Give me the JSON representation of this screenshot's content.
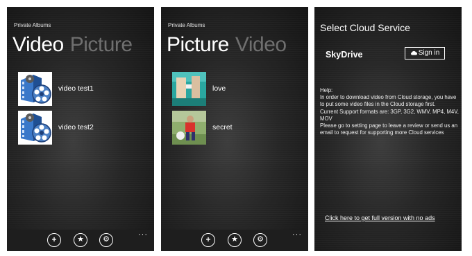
{
  "screens": {
    "video": {
      "app_name": "Private Albums",
      "pivot_active": "Video",
      "pivot_inactive": "Picture",
      "items": [
        {
          "label": "video test1"
        },
        {
          "label": "video test2"
        }
      ]
    },
    "picture": {
      "app_name": "Private Albums",
      "pivot_active": "Picture",
      "pivot_inactive": "Video",
      "items": [
        {
          "label": "love"
        },
        {
          "label": "secret"
        }
      ]
    },
    "cloud": {
      "title": "Select Cloud Service",
      "service": "SkyDrive",
      "signin_label": "Sign in",
      "help_lines": [
        "Help:",
        "In order to download video from Cloud storage, you have to put some video files in the Cloud storage first.",
        "Current Support formats are: 3GP, 3G2, WMV, MP4, M4V, MOV",
        "Please go to setting page to leave a review or send us an email to request for supporting more Cloud services"
      ],
      "full_version_link": "Click here to get full version with no ads"
    }
  },
  "appbar": {
    "add_glyph": "+",
    "favorite_glyph": "★",
    "settings_glyph": "⚙",
    "more_glyph": "···"
  },
  "icons": [
    "add-icon",
    "star-icon",
    "gear-icon",
    "more-icon",
    "cloud-icon"
  ],
  "colors": {
    "background": "#1b1b1b",
    "text": "#ffffff",
    "inactive_pivot": "#6f6f6f",
    "appbar": "#1e1e1e"
  }
}
